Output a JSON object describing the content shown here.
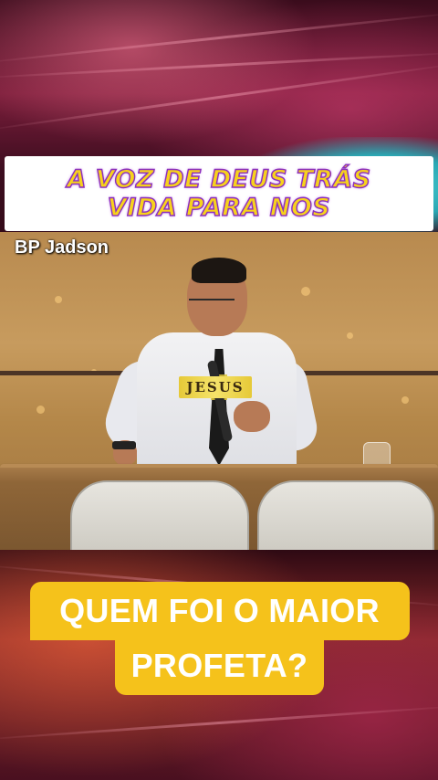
{
  "header": {
    "title": "A VOZ DE DEUS TRÁS VIDA PARA NOS"
  },
  "video": {
    "speaker_label": "BP Jadson",
    "pin_text": "JESUS"
  },
  "caption": {
    "line1": "QUEM FOI O MAIOR",
    "line2": "PROFETA?"
  },
  "colors": {
    "title_fill": "#f7d21c",
    "title_outline": "#8a2fbf",
    "caption_bg": "#f5c21b"
  }
}
